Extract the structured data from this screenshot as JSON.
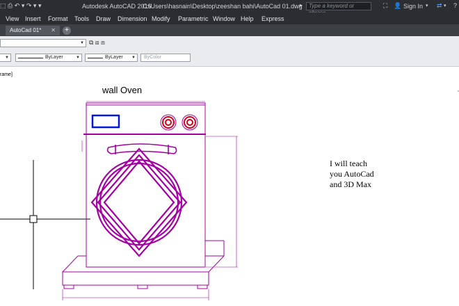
{
  "app": {
    "title": "Autodesk AutoCAD 2016",
    "file_path": "C:\\Users\\hasnain\\Desktop\\zeeshan bahi\\AutoCad 01.dwg",
    "search_placeholder": "Type a keyword or phrase",
    "sign_in": "Sign In"
  },
  "menu": {
    "items": [
      "View",
      "Insert",
      "Format",
      "Tools",
      "Draw",
      "Dimension",
      "Modify",
      "Parametric",
      "Window",
      "Help",
      "Express"
    ]
  },
  "tabs": {
    "active": "AutoCad 01*",
    "add": "+"
  },
  "properties": {
    "linetype": "ByLayer",
    "lineweight": "ByLayer",
    "plotstyle": "ByColor"
  },
  "canvas": {
    "viewport_label": "rame]",
    "drawing_title": "wall Oven",
    "annotation_lines": [
      "I will teach",
      "you AutoCad",
      "and 3D Max"
    ]
  },
  "colors": {
    "ribbon": "#2b2d31",
    "drawing": "#a400a4",
    "display": "#0018d8",
    "knob": "#d4001a"
  }
}
